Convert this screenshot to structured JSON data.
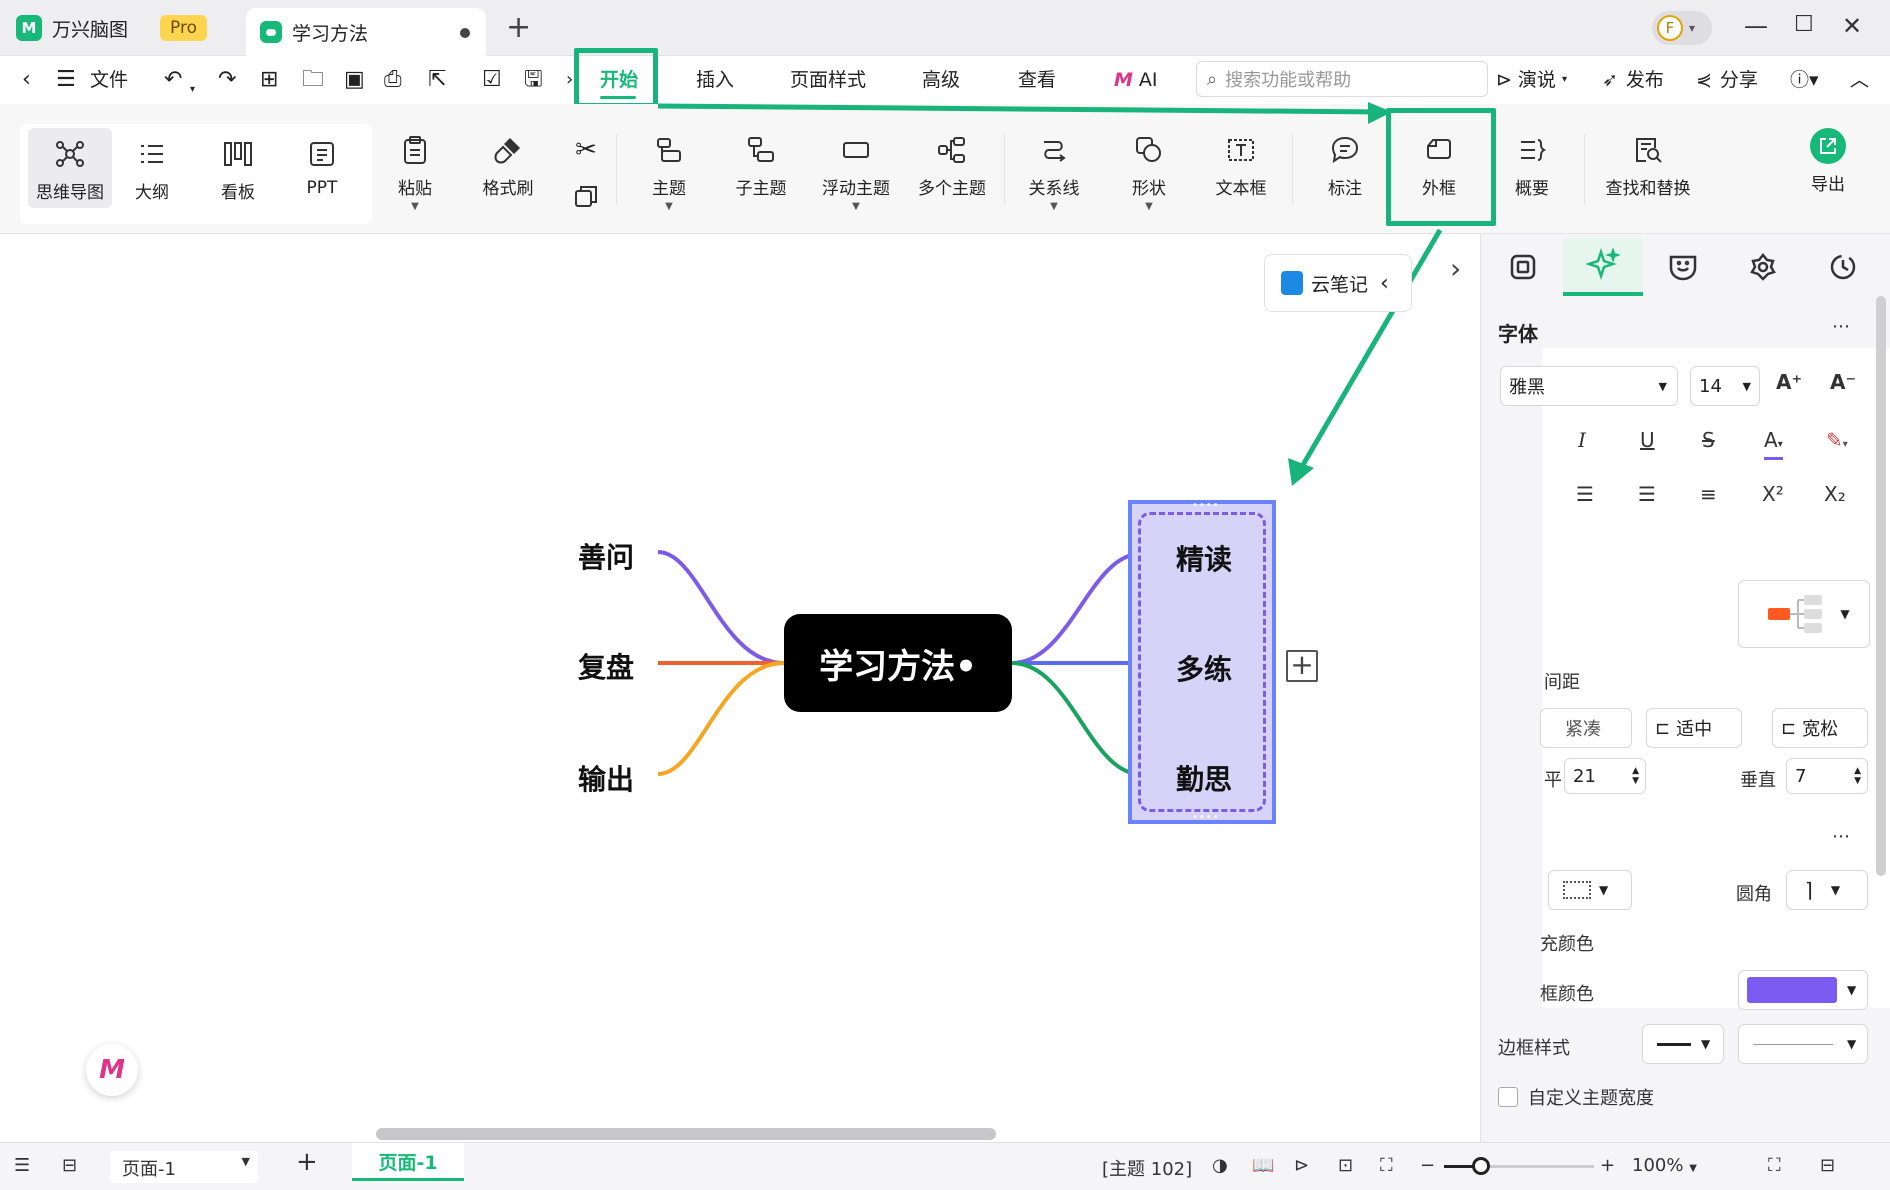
{
  "titlebar": {
    "app_name": "万兴脑图",
    "pro_badge": "Pro",
    "doc_tab": "学习方法",
    "new_tab": "+",
    "avatar_letter": "F"
  },
  "menubar": {
    "file": "文件",
    "tabs": [
      "开始",
      "插入",
      "页面样式",
      "高级",
      "查看",
      "AI"
    ],
    "search_placeholder": "搜索功能或帮助",
    "present": "演说",
    "publish": "发布",
    "share": "分享"
  },
  "toolbar": {
    "views": [
      "思维导图",
      "大纲",
      "看板",
      "PPT"
    ],
    "paste": "粘贴",
    "format_painter": "格式刷",
    "topic": "主题",
    "subtopic": "子主题",
    "floating_topic": "浮动主题",
    "multiple_topics": "多个主题",
    "relationship": "关系线",
    "shape": "形状",
    "textbox": "文本框",
    "callout": "标注",
    "boundary": "外框",
    "summary": "概要",
    "find_replace": "查找和替换",
    "export": "导出"
  },
  "canvas": {
    "cloud_note": "云笔记",
    "root": "学习方法•",
    "left_topics": [
      "善问",
      "复盘",
      "输出"
    ],
    "right_topics": [
      "精读",
      "多练",
      "勤思"
    ],
    "branch_colors": {
      "shanwen": "#7b5ce6",
      "fupan": "#f0612b",
      "shuchu": "#f5a623",
      "jingdu": "#7b5ce6",
      "duolian": "#5b6cf0",
      "qinsi": "#1aa35f"
    },
    "boundary_fill": "#d7d2f7",
    "boundary_border": "#6b82ff"
  },
  "panel": {
    "font_section": "字体",
    "font_name": "微软雅黑",
    "font_name_visible": "雅黑",
    "font_size": "14",
    "spacing_label": "间距",
    "spacing_options": [
      "紧凑",
      "适中",
      "宽松"
    ],
    "horizontal_label": "平",
    "horizontal_value": "21",
    "vertical_label": "垂直",
    "vertical_value": "7",
    "corner_label": "圆角",
    "fill_color_label": "填充颜色",
    "fill_color_visible": "充颜色",
    "border_color_label": "边框颜色",
    "border_color_visible": "框颜色",
    "border_color": "#7b5cf0",
    "border_style_label": "边框样式",
    "custom_width_label": "自定义主题宽度",
    "accent": "#17b978"
  },
  "statusbar": {
    "page_select": "页面-1",
    "page_tab": "页面-1",
    "topic_count": "[主题 102]",
    "zoom": "100%"
  },
  "annotation": {
    "highlight_color": "#18b47b"
  }
}
